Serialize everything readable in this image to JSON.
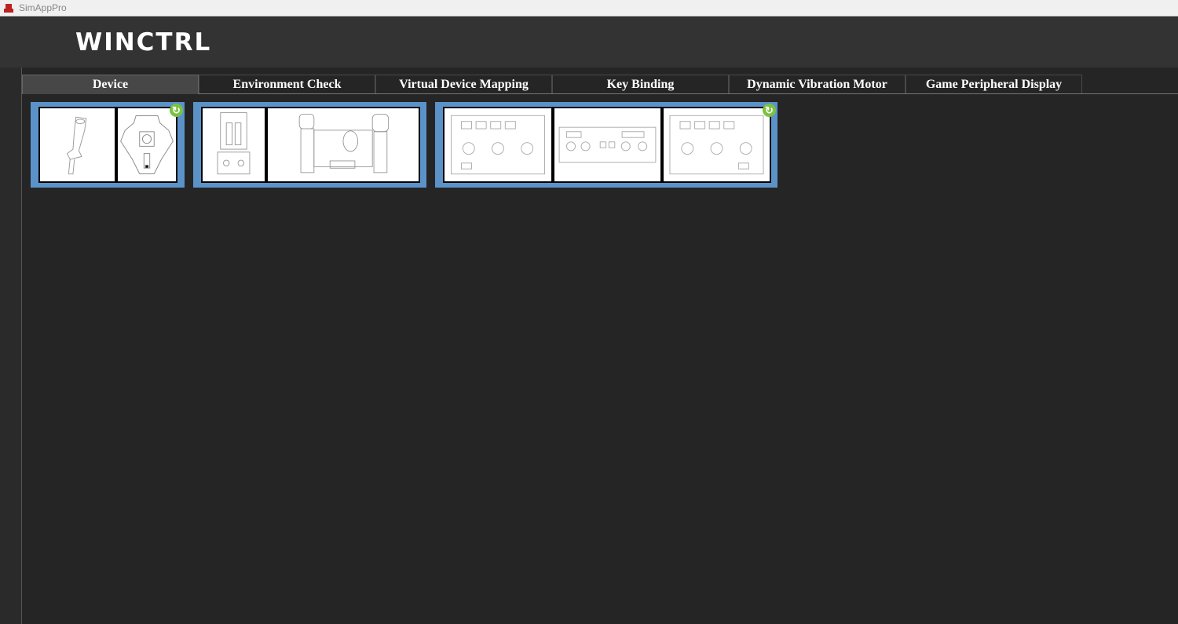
{
  "window": {
    "title": "SimAppPro"
  },
  "header": {
    "logo": "WINCTRL"
  },
  "tabs": [
    {
      "label": "Device",
      "active": true
    },
    {
      "label": "Environment Check"
    },
    {
      "label": "Virtual Device Mapping"
    },
    {
      "label": "Key Binding"
    },
    {
      "label": "Dynamic Vibration Motor"
    },
    {
      "label": "Game Peripheral Display"
    }
  ],
  "devices": [
    {
      "name": "joystick-grip-and-base",
      "images": [
        "joystick-grip",
        "joystick-base"
      ],
      "refresh_icon": true
    },
    {
      "name": "throttle",
      "images": [
        "throttle-top",
        "throttle-side"
      ],
      "refresh_icon": false
    },
    {
      "name": "control-panels",
      "images": [
        "panel-left",
        "panel-center",
        "panel-right"
      ],
      "refresh_icon": true
    }
  ],
  "colors": {
    "card": "#5b93c9",
    "refresh": "#7cc142",
    "background": "#252525",
    "header": "#333333"
  }
}
